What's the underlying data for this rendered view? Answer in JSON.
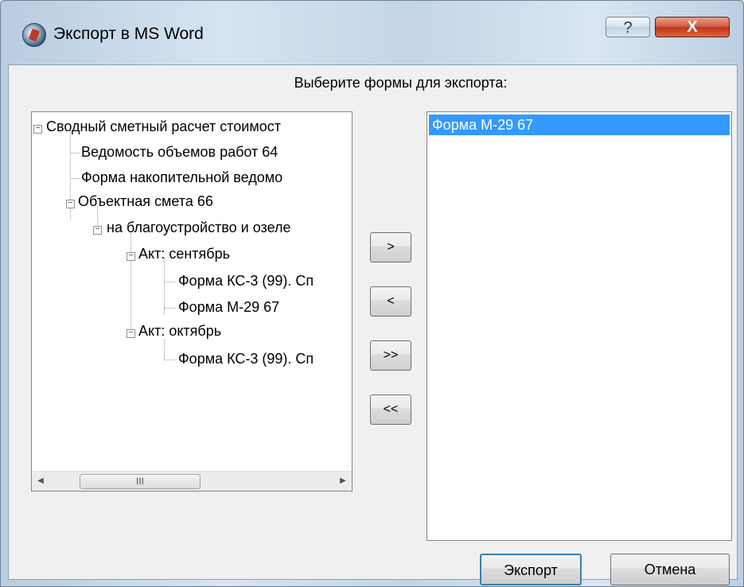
{
  "window": {
    "title": "Экспорт в MS Word",
    "help_label": "?",
    "close_label": "X"
  },
  "heading": "Выберите формы для экспорта:",
  "tree": {
    "items": [
      {
        "label": "Сводный сметный расчет стоимост"
      },
      {
        "label": "Ведомость объемов работ 64"
      },
      {
        "label": "Форма накопительной ведомо"
      },
      {
        "label": "Объектная смета 66"
      },
      {
        "label": "на благоустройство и озеле"
      },
      {
        "label": "Акт: сентябрь"
      },
      {
        "label": "Форма КС-3 (99). Сп"
      },
      {
        "label": "Форма М-29 67"
      },
      {
        "label": "Акт: октябрь"
      },
      {
        "label": "Форма КС-3 (99). Сп"
      }
    ],
    "scroll_thumb_grip": "III"
  },
  "move": {
    "add": ">",
    "remove": "<",
    "add_all": ">>",
    "remove_all": "<<"
  },
  "selected_list": {
    "items": [
      {
        "label": "Форма М-29 67",
        "selected": true
      }
    ]
  },
  "buttons": {
    "export": "Экспорт",
    "cancel": "Отмена"
  },
  "colors": {
    "selection": "#3399ff",
    "default_button_border": "#3c7fb1"
  }
}
